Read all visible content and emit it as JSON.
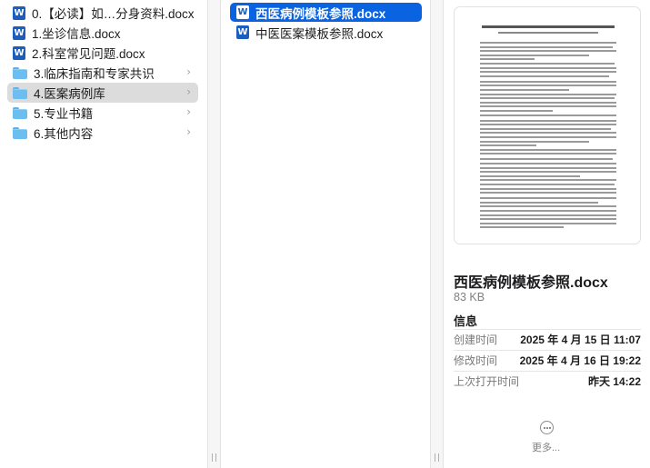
{
  "column1": {
    "items": [
      {
        "icon": "word-icon",
        "label": "0.【必读】如…分身资料.docx",
        "has_chevron": false
      },
      {
        "icon": "word-icon",
        "label": "1.坐诊信息.docx",
        "has_chevron": false
      },
      {
        "icon": "word-icon",
        "label": "2.科室常见问题.docx",
        "has_chevron": false
      },
      {
        "icon": "folder-icon",
        "label": "3.临床指南和专家共识",
        "has_chevron": true
      },
      {
        "icon": "folder-icon",
        "label": "4.医案病例库",
        "has_chevron": true
      },
      {
        "icon": "folder-icon",
        "label": "5.专业书籍",
        "has_chevron": true
      },
      {
        "icon": "folder-icon",
        "label": "6.其他内容",
        "has_chevron": true
      }
    ],
    "selected_index": 4
  },
  "column2": {
    "items": [
      {
        "icon": "word-icon",
        "label": "西医病例模板参照.docx"
      },
      {
        "icon": "word-icon",
        "label": "中医医案模板参照.docx"
      }
    ],
    "selected_index": 0
  },
  "icons": {
    "word_glyph": "W",
    "chevron_glyph": "›",
    "resize_glyph": "||"
  },
  "preview": {
    "file_name": "西医病例模板参照.docx",
    "file_size": "83 KB",
    "info_heading": "信息",
    "info": [
      {
        "key": "创建时间",
        "value": "2025 年 4 月 15 日 11:07"
      },
      {
        "key": "修改时间",
        "value": "2025 年 4 月 16 日 19:22"
      },
      {
        "key": "上次打开时间",
        "value": "昨天 14:22"
      }
    ],
    "more_label": "更多..."
  },
  "colors": {
    "selection_blue": "#0a63e0",
    "selection_grey": "#dcdcdc",
    "word_blue": "#1b5ebe",
    "folder_blue": "#6cbdf0"
  }
}
